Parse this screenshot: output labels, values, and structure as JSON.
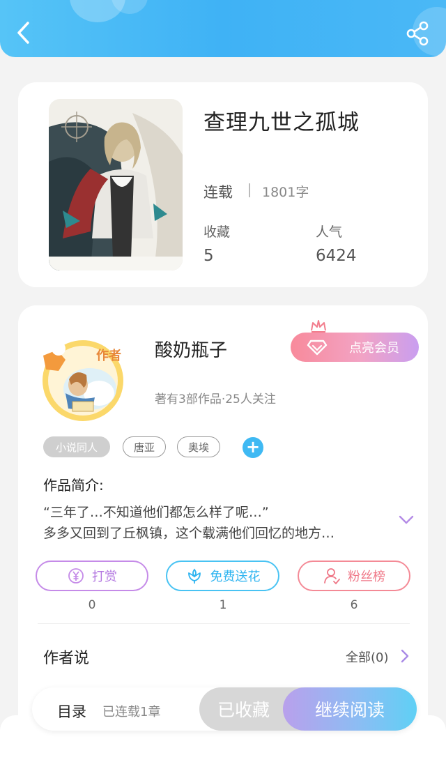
{
  "header": {
    "back_icon": "chevron-left-icon",
    "share_icon": "share-icon",
    "bg_color": "#45b6f5"
  },
  "book": {
    "title": "查理九世之孤城",
    "status": "连载",
    "word_count": "1801字",
    "favorites_label": "收藏",
    "favorites_value": "5",
    "popularity_label": "人气",
    "popularity_value": "6424"
  },
  "author": {
    "name": "酸奶瓶子",
    "avatar_badge": "作者",
    "stats": "著有3部作品·25人关注",
    "vip_button": "点亮会员",
    "tags": [
      "小说同人",
      "唐亚",
      "奥埃"
    ],
    "intro_title": "作品简介:",
    "intro_line1": "“三年了…不知道他们都怎么样了呢…”",
    "intro_line2": "多多又回到了丘枫镇，这个载满他们回忆的地方…",
    "actions": [
      {
        "label": "打赏",
        "count": "0",
        "icon": "yen-coin-icon"
      },
      {
        "label": "免费送花",
        "count": "1",
        "icon": "flower-icon"
      },
      {
        "label": "粉丝榜",
        "count": "6",
        "icon": "user-icon"
      }
    ],
    "author_says": "作者说",
    "all_link": "全部(0)"
  },
  "bottom_bar": {
    "toc_label": "目录",
    "toc_progress": "已连载1章",
    "collected_label": "已收藏",
    "continue_label": "继续阅读"
  },
  "colors": {
    "accent_blue": "#3fb9f3",
    "vip_pink": "#f88a9b",
    "reward_purple": "#c58be8",
    "fans_red": "#f48a96"
  }
}
